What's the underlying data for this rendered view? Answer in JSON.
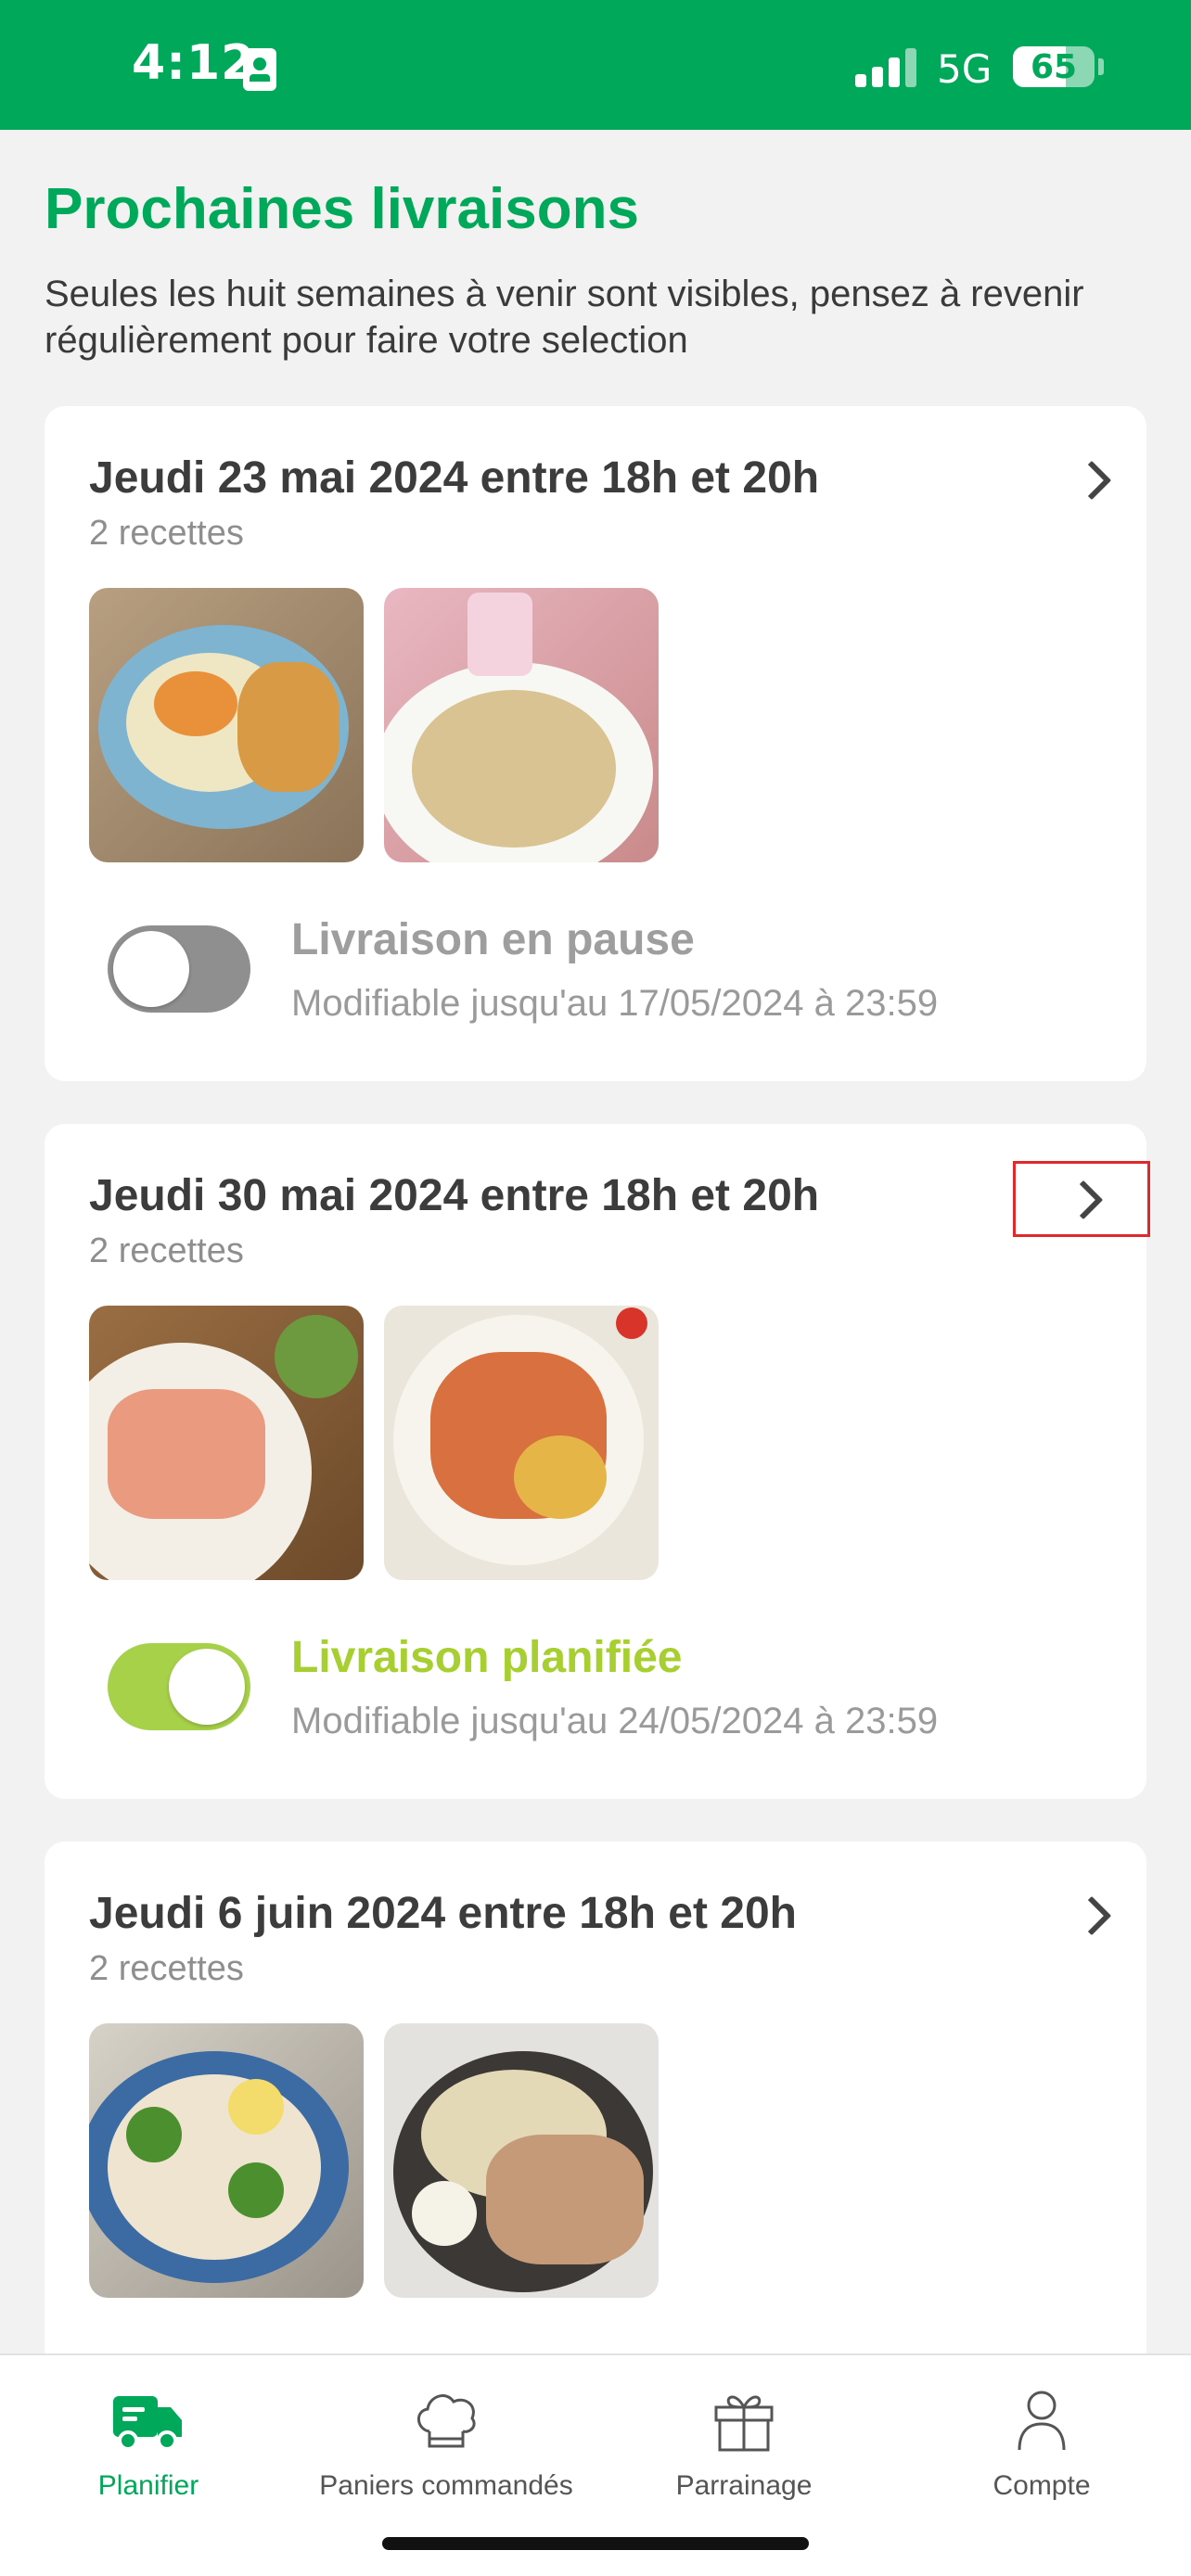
{
  "status_bar": {
    "time": "4:12",
    "network": "5G",
    "battery": "65",
    "battery_level": 0.65
  },
  "header": {
    "title": "Prochaines livraisons",
    "subtitle": "Seules les huit semaines à venir sont visibles, pensez à revenir régulièrement pour faire votre selection"
  },
  "deliveries": [
    {
      "title": "Jeudi 23 mai 2024 entre 18h et 20h",
      "count": "2 recettes",
      "status": "Livraison en pause",
      "deadline": "Modifiable jusqu'au 17/05/2024 à 23:59",
      "enabled": false
    },
    {
      "title": "Jeudi 30 mai 2024 entre 18h et 20h",
      "count": "2 recettes",
      "status": "Livraison planifiée",
      "deadline": "Modifiable jusqu'au 24/05/2024 à 23:59",
      "enabled": true
    },
    {
      "title": "Jeudi 6 juin 2024 entre 18h et 20h",
      "count": "2 recettes"
    }
  ],
  "nav": {
    "items": [
      {
        "label": "Planifier",
        "icon": "delivery-truck-icon"
      },
      {
        "label": "Paniers commandés",
        "icon": "chef-hat-icon"
      },
      {
        "label": "Parrainage",
        "icon": "gift-icon"
      },
      {
        "label": "Compte",
        "icon": "user-icon"
      }
    ],
    "active": "Planifier"
  },
  "colors": {
    "brand": "#00a85a",
    "toggle_on": "#a8d14a",
    "toggle_off": "#8f8f8f",
    "highlight": "#e0292b"
  }
}
